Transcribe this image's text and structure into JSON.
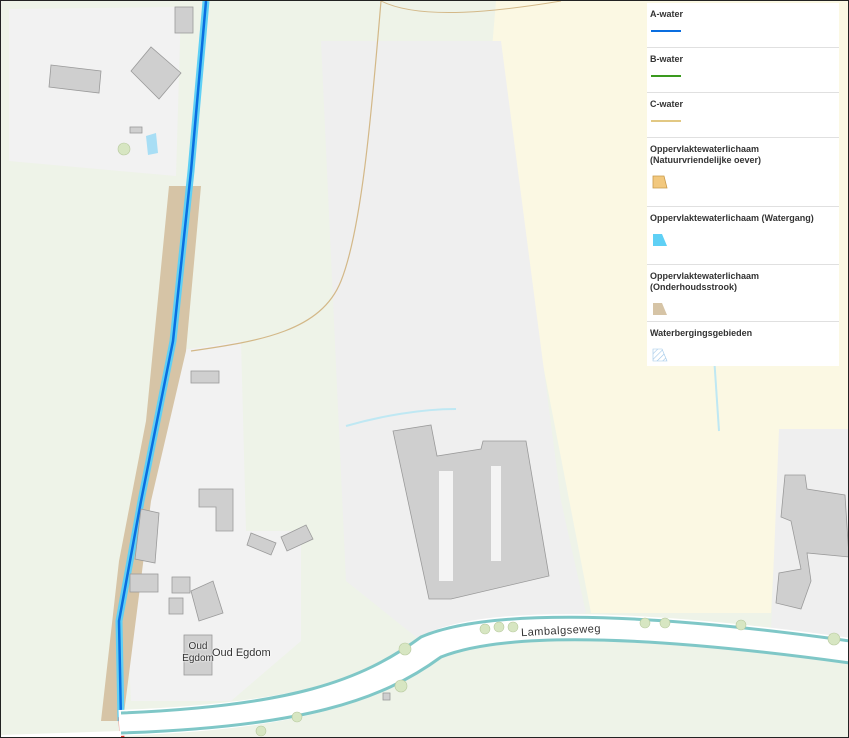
{
  "map": {
    "labels": {
      "road": "Lambalgseweg",
      "place": "Oud Egdom",
      "building_line1": "Oud",
      "building_line2": "Egdom"
    },
    "colors": {
      "a_water": "#0a6ee0",
      "b_water": "#3a9a1e",
      "c_water": "#d8b65a",
      "oever": "#f2c87e",
      "watergang": "#5fd0f5",
      "onderhoudsstrook": "#d6c4a6",
      "waterberging": "#9fc7e8",
      "building": "#cfcfcf",
      "road_casing": "#7fc7c7"
    }
  },
  "legend": {
    "items": [
      {
        "label": "A-water",
        "swatch": "line",
        "icon": "blue-line-icon"
      },
      {
        "label": "B-water",
        "swatch": "line",
        "icon": "green-line-icon"
      },
      {
        "label": "C-water",
        "swatch": "line",
        "icon": "tan-line-icon"
      },
      {
        "label": "Oppervlaktewaterlichaam (Natuurvriendelijke oever)",
        "swatch": "polygon",
        "icon": "orange-polygon-icon"
      },
      {
        "label": "Oppervlaktewaterlichaam (Watergang)",
        "swatch": "polygon",
        "icon": "cyan-polygon-icon"
      },
      {
        "label": "Oppervlaktewaterlichaam (Onderhoudsstrook)",
        "swatch": "polygon",
        "icon": "beige-polygon-icon"
      },
      {
        "label": "Waterbergingsgebieden",
        "swatch": "hatched",
        "icon": "hatched-polygon-icon"
      }
    ]
  }
}
